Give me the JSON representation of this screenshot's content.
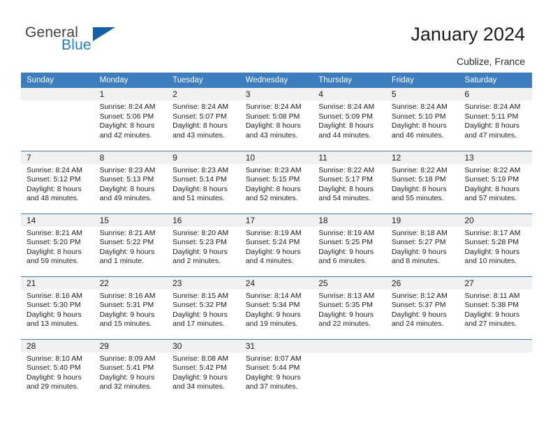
{
  "brand": {
    "name_part1": "General",
    "name_part2": "Blue"
  },
  "header": {
    "title": "January 2024",
    "location": "Cublize, France"
  },
  "colors": {
    "header_blue": "#3b7dbf",
    "logo_blue": "#1f7ec4",
    "daynum_band": "#f0f0f0"
  },
  "weekday_headers": [
    "Sunday",
    "Monday",
    "Tuesday",
    "Wednesday",
    "Thursday",
    "Friday",
    "Saturday"
  ],
  "weeks": [
    [
      {
        "day": "",
        "sunrise": "",
        "sunset": "",
        "daylight1": "",
        "daylight2": ""
      },
      {
        "day": "1",
        "sunrise": "Sunrise: 8:24 AM",
        "sunset": "Sunset: 5:06 PM",
        "daylight1": "Daylight: 8 hours",
        "daylight2": "and 42 minutes."
      },
      {
        "day": "2",
        "sunrise": "Sunrise: 8:24 AM",
        "sunset": "Sunset: 5:07 PM",
        "daylight1": "Daylight: 8 hours",
        "daylight2": "and 43 minutes."
      },
      {
        "day": "3",
        "sunrise": "Sunrise: 8:24 AM",
        "sunset": "Sunset: 5:08 PM",
        "daylight1": "Daylight: 8 hours",
        "daylight2": "and 43 minutes."
      },
      {
        "day": "4",
        "sunrise": "Sunrise: 8:24 AM",
        "sunset": "Sunset: 5:09 PM",
        "daylight1": "Daylight: 8 hours",
        "daylight2": "and 44 minutes."
      },
      {
        "day": "5",
        "sunrise": "Sunrise: 8:24 AM",
        "sunset": "Sunset: 5:10 PM",
        "daylight1": "Daylight: 8 hours",
        "daylight2": "and 46 minutes."
      },
      {
        "day": "6",
        "sunrise": "Sunrise: 8:24 AM",
        "sunset": "Sunset: 5:11 PM",
        "daylight1": "Daylight: 8 hours",
        "daylight2": "and 47 minutes."
      }
    ],
    [
      {
        "day": "7",
        "sunrise": "Sunrise: 8:24 AM",
        "sunset": "Sunset: 5:12 PM",
        "daylight1": "Daylight: 8 hours",
        "daylight2": "and 48 minutes."
      },
      {
        "day": "8",
        "sunrise": "Sunrise: 8:23 AM",
        "sunset": "Sunset: 5:13 PM",
        "daylight1": "Daylight: 8 hours",
        "daylight2": "and 49 minutes."
      },
      {
        "day": "9",
        "sunrise": "Sunrise: 8:23 AM",
        "sunset": "Sunset: 5:14 PM",
        "daylight1": "Daylight: 8 hours",
        "daylight2": "and 51 minutes."
      },
      {
        "day": "10",
        "sunrise": "Sunrise: 8:23 AM",
        "sunset": "Sunset: 5:15 PM",
        "daylight1": "Daylight: 8 hours",
        "daylight2": "and 52 minutes."
      },
      {
        "day": "11",
        "sunrise": "Sunrise: 8:22 AM",
        "sunset": "Sunset: 5:17 PM",
        "daylight1": "Daylight: 8 hours",
        "daylight2": "and 54 minutes."
      },
      {
        "day": "12",
        "sunrise": "Sunrise: 8:22 AM",
        "sunset": "Sunset: 5:18 PM",
        "daylight1": "Daylight: 8 hours",
        "daylight2": "and 55 minutes."
      },
      {
        "day": "13",
        "sunrise": "Sunrise: 8:22 AM",
        "sunset": "Sunset: 5:19 PM",
        "daylight1": "Daylight: 8 hours",
        "daylight2": "and 57 minutes."
      }
    ],
    [
      {
        "day": "14",
        "sunrise": "Sunrise: 8:21 AM",
        "sunset": "Sunset: 5:20 PM",
        "daylight1": "Daylight: 8 hours",
        "daylight2": "and 59 minutes."
      },
      {
        "day": "15",
        "sunrise": "Sunrise: 8:21 AM",
        "sunset": "Sunset: 5:22 PM",
        "daylight1": "Daylight: 9 hours",
        "daylight2": "and 1 minute."
      },
      {
        "day": "16",
        "sunrise": "Sunrise: 8:20 AM",
        "sunset": "Sunset: 5:23 PM",
        "daylight1": "Daylight: 9 hours",
        "daylight2": "and 2 minutes."
      },
      {
        "day": "17",
        "sunrise": "Sunrise: 8:19 AM",
        "sunset": "Sunset: 5:24 PM",
        "daylight1": "Daylight: 9 hours",
        "daylight2": "and 4 minutes."
      },
      {
        "day": "18",
        "sunrise": "Sunrise: 8:19 AM",
        "sunset": "Sunset: 5:25 PM",
        "daylight1": "Daylight: 9 hours",
        "daylight2": "and 6 minutes."
      },
      {
        "day": "19",
        "sunrise": "Sunrise: 8:18 AM",
        "sunset": "Sunset: 5:27 PM",
        "daylight1": "Daylight: 9 hours",
        "daylight2": "and 8 minutes."
      },
      {
        "day": "20",
        "sunrise": "Sunrise: 8:17 AM",
        "sunset": "Sunset: 5:28 PM",
        "daylight1": "Daylight: 9 hours",
        "daylight2": "and 10 minutes."
      }
    ],
    [
      {
        "day": "21",
        "sunrise": "Sunrise: 8:16 AM",
        "sunset": "Sunset: 5:30 PM",
        "daylight1": "Daylight: 9 hours",
        "daylight2": "and 13 minutes."
      },
      {
        "day": "22",
        "sunrise": "Sunrise: 8:16 AM",
        "sunset": "Sunset: 5:31 PM",
        "daylight1": "Daylight: 9 hours",
        "daylight2": "and 15 minutes."
      },
      {
        "day": "23",
        "sunrise": "Sunrise: 8:15 AM",
        "sunset": "Sunset: 5:32 PM",
        "daylight1": "Daylight: 9 hours",
        "daylight2": "and 17 minutes."
      },
      {
        "day": "24",
        "sunrise": "Sunrise: 8:14 AM",
        "sunset": "Sunset: 5:34 PM",
        "daylight1": "Daylight: 9 hours",
        "daylight2": "and 19 minutes."
      },
      {
        "day": "25",
        "sunrise": "Sunrise: 8:13 AM",
        "sunset": "Sunset: 5:35 PM",
        "daylight1": "Daylight: 9 hours",
        "daylight2": "and 22 minutes."
      },
      {
        "day": "26",
        "sunrise": "Sunrise: 8:12 AM",
        "sunset": "Sunset: 5:37 PM",
        "daylight1": "Daylight: 9 hours",
        "daylight2": "and 24 minutes."
      },
      {
        "day": "27",
        "sunrise": "Sunrise: 8:11 AM",
        "sunset": "Sunset: 5:38 PM",
        "daylight1": "Daylight: 9 hours",
        "daylight2": "and 27 minutes."
      }
    ],
    [
      {
        "day": "28",
        "sunrise": "Sunrise: 8:10 AM",
        "sunset": "Sunset: 5:40 PM",
        "daylight1": "Daylight: 9 hours",
        "daylight2": "and 29 minutes."
      },
      {
        "day": "29",
        "sunrise": "Sunrise: 8:09 AM",
        "sunset": "Sunset: 5:41 PM",
        "daylight1": "Daylight: 9 hours",
        "daylight2": "and 32 minutes."
      },
      {
        "day": "30",
        "sunrise": "Sunrise: 8:08 AM",
        "sunset": "Sunset: 5:42 PM",
        "daylight1": "Daylight: 9 hours",
        "daylight2": "and 34 minutes."
      },
      {
        "day": "31",
        "sunrise": "Sunrise: 8:07 AM",
        "sunset": "Sunset: 5:44 PM",
        "daylight1": "Daylight: 9 hours",
        "daylight2": "and 37 minutes."
      },
      {
        "day": "",
        "sunrise": "",
        "sunset": "",
        "daylight1": "",
        "daylight2": ""
      },
      {
        "day": "",
        "sunrise": "",
        "sunset": "",
        "daylight1": "",
        "daylight2": ""
      },
      {
        "day": "",
        "sunrise": "",
        "sunset": "",
        "daylight1": "",
        "daylight2": ""
      }
    ]
  ]
}
